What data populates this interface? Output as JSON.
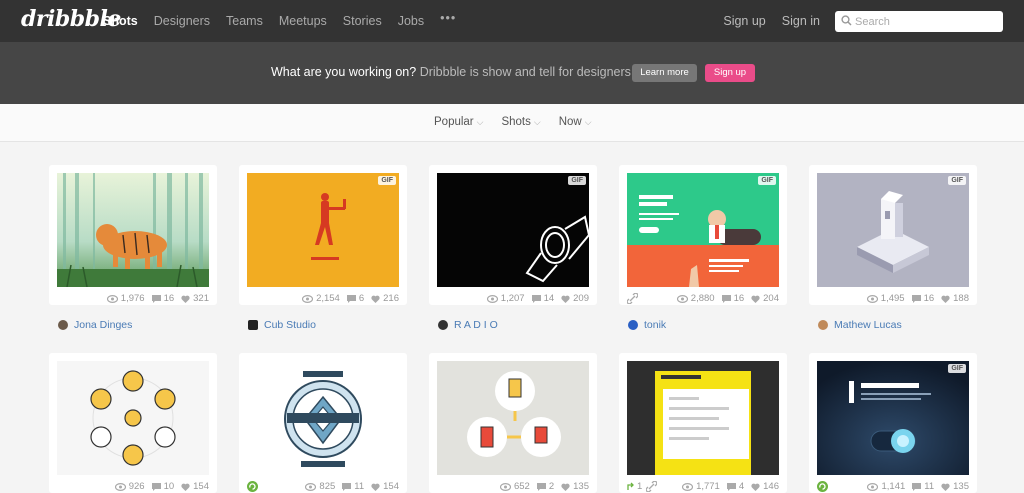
{
  "brand": {
    "logo": "dribbble"
  },
  "nav": {
    "links": [
      "Shots",
      "Designers",
      "Teams",
      "Meetups",
      "Stories",
      "Jobs"
    ],
    "more": "•••",
    "signup": "Sign up",
    "signin": "Sign in"
  },
  "search": {
    "placeholder": "Search"
  },
  "banner": {
    "question": "What are you working on?",
    "tagline": "Dribbble is show and tell for designers.",
    "learn_more": "Learn more",
    "signup": "Sign up"
  },
  "filters": [
    "Popular",
    "Shots",
    "Now"
  ],
  "shots": [
    {
      "author": "Jona Dinges",
      "views": "1,976",
      "comments": "16",
      "likes": "321"
    },
    {
      "author": "Cub Studio",
      "views": "2,154",
      "comments": "6",
      "likes": "216",
      "badge": "GIF"
    },
    {
      "author": "R A D I O",
      "views": "1,207",
      "comments": "14",
      "likes": "209",
      "badge": "GIF"
    },
    {
      "author": "tonik",
      "views": "2,880",
      "comments": "16",
      "likes": "204",
      "badge": "GIF"
    },
    {
      "author": "Mathew Lucas",
      "views": "1,495",
      "comments": "16",
      "likes": "188",
      "badge": "GIF"
    },
    {
      "views": "926",
      "comments": "10",
      "likes": "154"
    },
    {
      "views": "825",
      "comments": "11",
      "likes": "154"
    },
    {
      "views": "652",
      "comments": "2",
      "likes": "135"
    },
    {
      "rebounds": "1",
      "views": "1,771",
      "comments": "4",
      "likes": "146"
    },
    {
      "views": "1,141",
      "comments": "11",
      "likes": "135",
      "badge": "GIF"
    }
  ],
  "colors": {
    "brand_pink": "#ea4c89",
    "nav_bg": "#333333",
    "banner_bg": "#464646"
  }
}
